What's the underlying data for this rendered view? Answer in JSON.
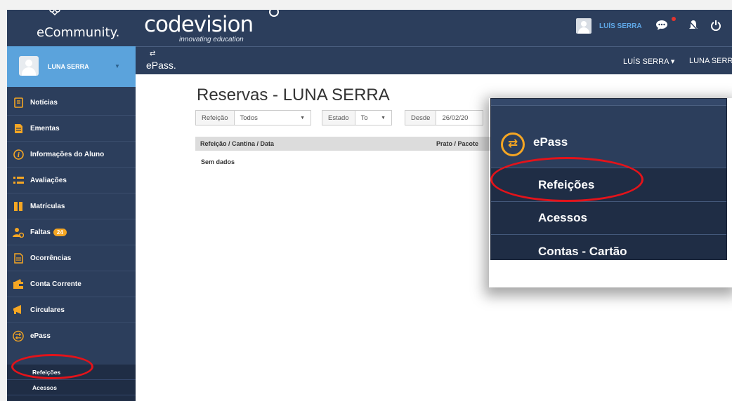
{
  "brand": {
    "app_name": "eCommunity."
  },
  "header": {
    "logo_word": "codevision",
    "logo_tagline": "innovating education",
    "user_name": "LUÍS SERRA"
  },
  "user_panel": {
    "name": "LUNA SERRA"
  },
  "subheader": {
    "module": "ePass.",
    "module_icon": "epass-icon",
    "user_menu": "LUÍS SERRA ▾",
    "student_menu": "LUNA SERRA"
  },
  "sidebar": {
    "items": [
      {
        "label": "Notícias",
        "icon": "news-icon"
      },
      {
        "label": "Ementas",
        "icon": "menu-doc-icon"
      },
      {
        "label": "Informações do Aluno",
        "icon": "info-icon"
      },
      {
        "label": "Avaliações",
        "icon": "list-icon"
      },
      {
        "label": "Matrículas",
        "icon": "book-icon"
      },
      {
        "label": "Faltas",
        "icon": "people-icon",
        "badge": "24"
      },
      {
        "label": "Ocorrências",
        "icon": "doc-icon"
      },
      {
        "label": "Conta Corrente",
        "icon": "wallet-icon"
      },
      {
        "label": "Circulares",
        "icon": "megaphone-icon"
      },
      {
        "label": "ePass",
        "icon": "epass-icon"
      }
    ],
    "sub_items": [
      {
        "label": "Refeições"
      },
      {
        "label": "Acessos"
      },
      {
        "label": "Contas - Cartão"
      }
    ]
  },
  "main": {
    "title": "Reservas - LUNA SERRA",
    "filters": {
      "refeicao_label": "Refeição",
      "refeicao_value": "Todos",
      "estado_label": "Estado",
      "estado_value": "To",
      "desde_label": "Desde",
      "desde_value": "26/02/20"
    },
    "table": {
      "columns": [
        "Refeição / Cantina / Data",
        "Prato / Pacote"
      ],
      "empty_text": "Sem dados"
    }
  },
  "zoom_panel": {
    "title": "ePass",
    "items": [
      "Refeições",
      "Acessos",
      "Contas - Cartão"
    ]
  },
  "colors": {
    "navy": "#2c3e5c",
    "accent_blue": "#5ba3dc",
    "orange": "#f5a623",
    "highlight_red": "#e3131a"
  }
}
